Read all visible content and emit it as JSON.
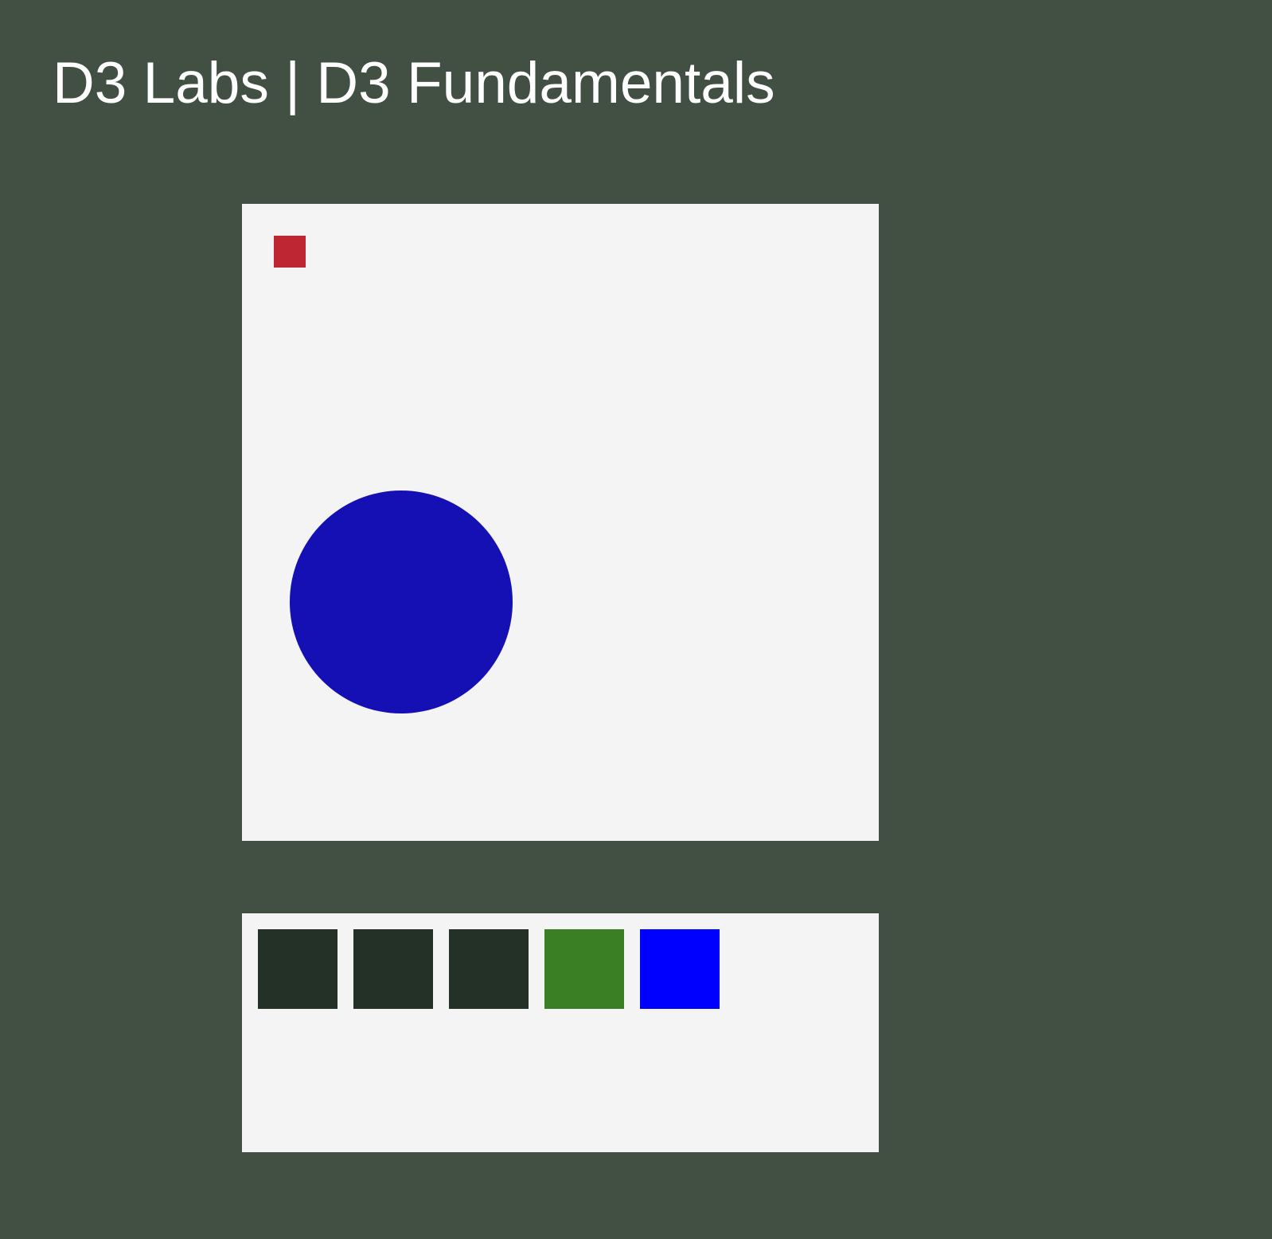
{
  "page": {
    "title": "D3 Labs | D3 Fundamentals",
    "background_color": "#415043",
    "panel_color": "#f4f4f4"
  },
  "shapes": {
    "square": {
      "shape": "square",
      "color": "#be2633"
    },
    "circle": {
      "shape": "circle",
      "color": "#1410b4"
    }
  },
  "swatches": [
    {
      "color": "#243127"
    },
    {
      "color": "#243127"
    },
    {
      "color": "#243127"
    },
    {
      "color": "#3a7f24"
    },
    {
      "color": "#0000ff"
    }
  ]
}
